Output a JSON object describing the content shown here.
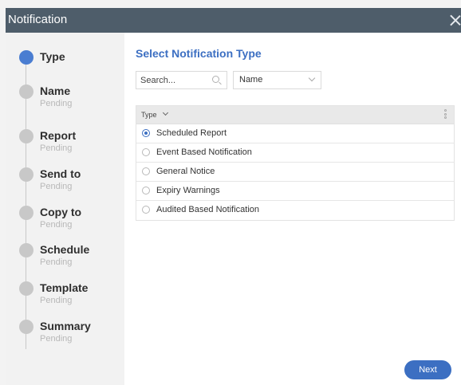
{
  "dialog": {
    "title": "Notification",
    "close_icon": "close-icon"
  },
  "steps": [
    {
      "name": "Type",
      "status": "",
      "active": true
    },
    {
      "name": "Name",
      "status": "Pending",
      "active": false
    },
    {
      "name": "Report",
      "status": "Pending",
      "active": false
    },
    {
      "name": "Send to",
      "status": "Pending",
      "active": false
    },
    {
      "name": "Copy to",
      "status": "Pending",
      "active": false
    },
    {
      "name": "Schedule",
      "status": "Pending",
      "active": false
    },
    {
      "name": "Template",
      "status": "Pending",
      "active": false
    },
    {
      "name": "Summary",
      "status": "Pending",
      "active": false
    }
  ],
  "main": {
    "heading": "Select Notification Type",
    "search": {
      "placeholder": "Search...",
      "value": "",
      "icon": "search-icon"
    },
    "sort_select": {
      "value": "Name",
      "icon": "chevron-down-icon"
    }
  },
  "table": {
    "header": "Type",
    "header_icon": "chevron-down-icon",
    "menu_icon": "kebab-menu-icon",
    "rows": [
      {
        "label": "Scheduled Report",
        "selected": true
      },
      {
        "label": "Event Based Notification",
        "selected": false
      },
      {
        "label": "General Notice",
        "selected": false
      },
      {
        "label": "Expiry Warnings",
        "selected": false
      },
      {
        "label": "Audited Based Notification",
        "selected": false
      }
    ]
  },
  "footer": {
    "next_label": "Next"
  },
  "colors": {
    "titlebar": "#4e5d6a",
    "accent": "#3c6fc2",
    "active_step": "#4a7dd1",
    "inactive_step": "#c8c8c8",
    "sidebar_bg": "#f2f2f2"
  }
}
